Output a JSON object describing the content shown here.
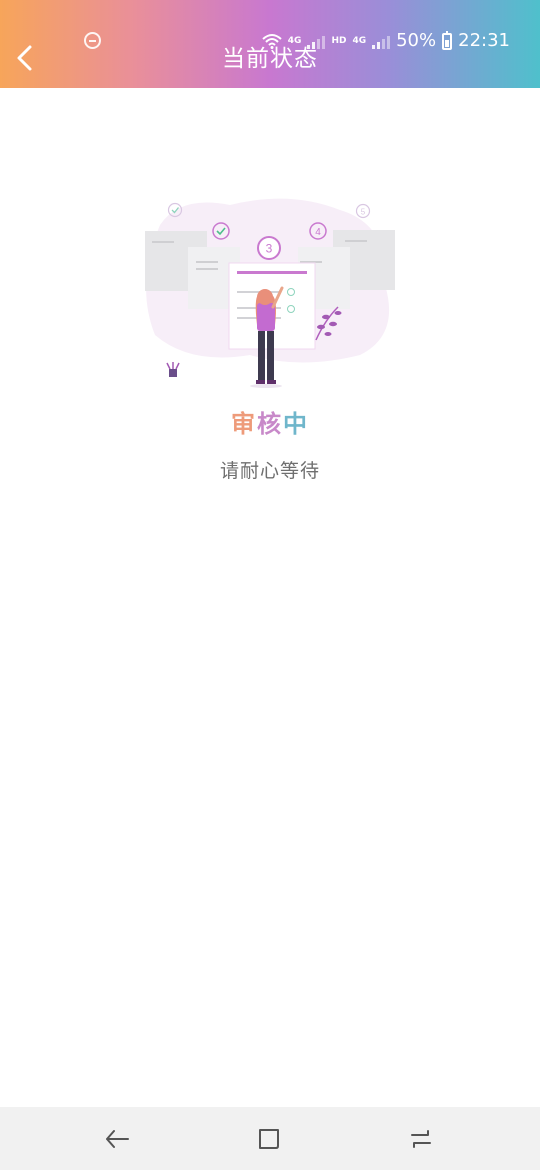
{
  "status_bar": {
    "network_label_1": "4G",
    "hd_label": "HD",
    "network_label_2": "4G",
    "battery": "50%",
    "time": "22:31",
    "icons": [
      "do-not-disturb-icon",
      "wifi-icon",
      "signal-icon",
      "battery-icon"
    ]
  },
  "header": {
    "title": "当前状态",
    "back_icon": "chevron-left-icon",
    "gradient": [
      "#f7a55a",
      "#e98f9a",
      "#c878d0",
      "#9a8ed8",
      "#4fc0cc"
    ]
  },
  "illustration": {
    "step_current": "3",
    "step_next": "4",
    "step_last": "5",
    "icon": "review-progress-illustration"
  },
  "status": {
    "title_chars": [
      "审",
      "核",
      "中"
    ],
    "subtitle": "请耐心等待",
    "colors": [
      "#ee9b7a",
      "#c889c9",
      "#6fb6cb"
    ]
  },
  "nav_bar": {
    "icons": [
      "nav-back-icon",
      "nav-home-icon",
      "nav-recents-icon"
    ]
  }
}
